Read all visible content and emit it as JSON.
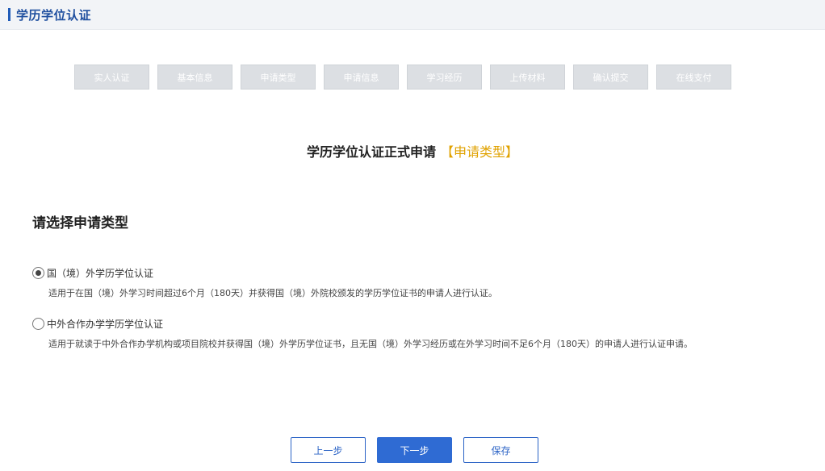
{
  "header": {
    "title": "学历学位认证"
  },
  "steps": [
    "实人认证",
    "基本信息",
    "申请类型",
    "申请信息",
    "学习经历",
    "上传材料",
    "确认提交",
    "在线支付"
  ],
  "main": {
    "title": "学历学位认证正式申请",
    "current_step": "【申请类型】",
    "section_title": "请选择申请类型"
  },
  "options": [
    {
      "label": "国（境）外学历学位认证",
      "desc": "适用于在国（境）外学习时间超过6个月（180天）并获得国（境）外院校颁发的学历学位证书的申请人进行认证。",
      "checked": true
    },
    {
      "label": "中外合作办学学历学位认证",
      "desc": "适用于就读于中外合作办学机构或项目院校并获得国（境）外学历学位证书，且无国（境）外学习经历或在外学习时间不足6个月（180天）的申请人进行认证申请。",
      "checked": false
    }
  ],
  "buttons": {
    "prev": "上一步",
    "next": "下一步",
    "save": "保存"
  }
}
